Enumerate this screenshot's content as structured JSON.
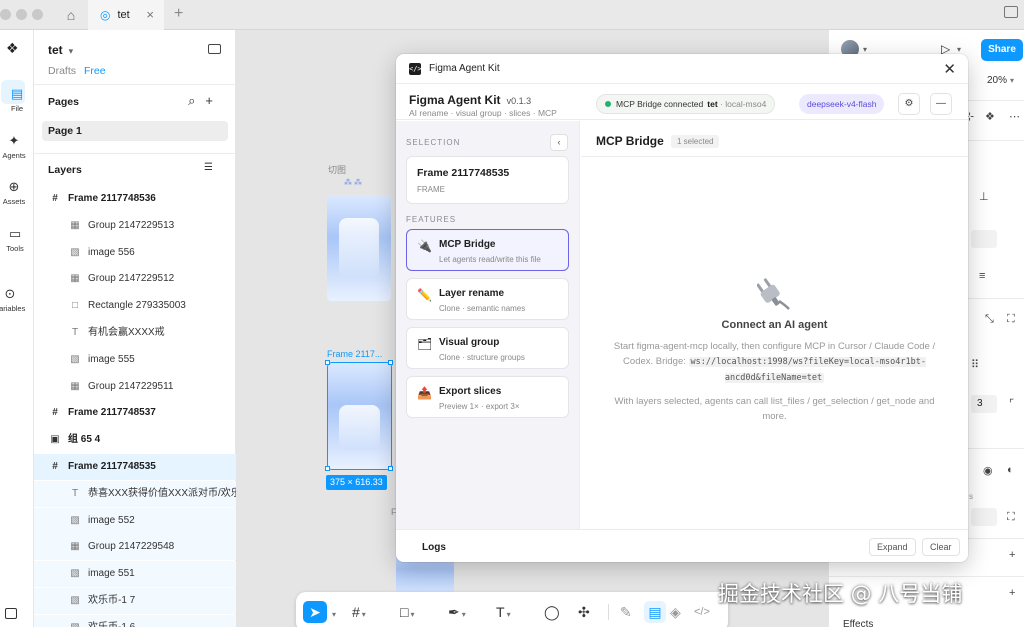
{
  "tabs": {
    "file_tab": "tet"
  },
  "rail": [
    {
      "label": "File",
      "icon": "file-icon"
    },
    {
      "label": "Agents",
      "icon": "agents-icon"
    },
    {
      "label": "Assets",
      "icon": "assets-icon"
    },
    {
      "label": "Tools",
      "icon": "tools-icon"
    },
    {
      "label": "Variables",
      "icon": "variables-icon"
    }
  ],
  "left_panel": {
    "file_name": "tet",
    "drafts": "Drafts",
    "plan": "Free",
    "pages_title": "Pages",
    "page": "Page 1",
    "layers_title": "Layers",
    "layers": [
      {
        "name": "Frame 2117748536",
        "icon": "#",
        "level": 0
      },
      {
        "name": "Group 2147229513",
        "icon": "▦",
        "level": 1
      },
      {
        "name": "image 556",
        "icon": "▧",
        "level": 1
      },
      {
        "name": "Group 2147229512",
        "icon": "▦",
        "level": 1
      },
      {
        "name": "Rectangle 279335003",
        "icon": "□",
        "level": 1
      },
      {
        "name": "有机会赢XXXX戒",
        "icon": "T",
        "level": 1
      },
      {
        "name": "image 555",
        "icon": "▧",
        "level": 1
      },
      {
        "name": "Group 2147229511",
        "icon": "▦",
        "level": 1
      },
      {
        "name": "Frame 2117748537",
        "icon": "#",
        "level": 0
      },
      {
        "name": "组 65 4",
        "icon": "▣",
        "level": 0
      },
      {
        "name": "Frame 2117748535",
        "icon": "#",
        "level": 0
      },
      {
        "name": "恭喜XXX获得价值XXX派对币/欢乐豆",
        "icon": "T",
        "level": 1
      },
      {
        "name": "image 552",
        "icon": "▧",
        "level": 1
      },
      {
        "name": "Group 2147229548",
        "icon": "▦",
        "level": 1
      },
      {
        "name": "image 551",
        "icon": "▧",
        "level": 1
      },
      {
        "name": "欢乐币-1 7",
        "icon": "▧",
        "level": 1
      },
      {
        "name": "欢乐币-1 6",
        "icon": "▧",
        "level": 1
      }
    ]
  },
  "canvas": {
    "label_a": "切图",
    "label_b": "Frame 2117...",
    "label_c": "F",
    "dim_badge": "375 × 616.33"
  },
  "right_panel": {
    "share": "Share",
    "zoom": "20%",
    "input_value": "3",
    "effects": "Effects",
    "small_text": "s"
  },
  "plugin": {
    "window_title": "Figma Agent Kit",
    "name": "Figma Agent Kit",
    "version": "v0.1.3",
    "desc": "AI rename · visual group · slices · MCP",
    "mcp_status": "MCP Bridge connected",
    "mcp_file": "tet",
    "mcp_host": "· local-mso4",
    "model": "deepseek-v4-flash",
    "selection_label": "SELECTION",
    "selected_name": "Frame 2117748535",
    "selected_type": "FRAME",
    "features_label": "FEATURES",
    "features": [
      {
        "title": "MCP Bridge",
        "desc": "Let agents read/write this file",
        "icon": "🔌"
      },
      {
        "title": "Layer rename",
        "desc": "Clone · semantic names",
        "icon": "✏️"
      },
      {
        "title": "Visual group",
        "desc": "Clone · structure groups",
        "icon": "🗂"
      },
      {
        "title": "Export slices",
        "desc": "Preview 1× · export 3×",
        "icon": "📤"
      }
    ],
    "main_title": "MCP Bridge",
    "main_badge": "1 selected",
    "empty_title": "Connect an AI agent",
    "empty_p1_a": "Start figma-agent-mcp locally, then configure MCP in Cursor / Claude Code / Codex. Bridge: ",
    "empty_code": "ws://localhost:1998/ws?fileKey=local-mso4r1bt-ancd0d&fileName=tet",
    "empty_p2": "With layers selected, agents can call list_files / get_selection / get_node and more.",
    "logs": "Logs",
    "expand": "Expand",
    "clear": "Clear"
  },
  "watermark": "掘金技术社区 @ 八号当铺"
}
